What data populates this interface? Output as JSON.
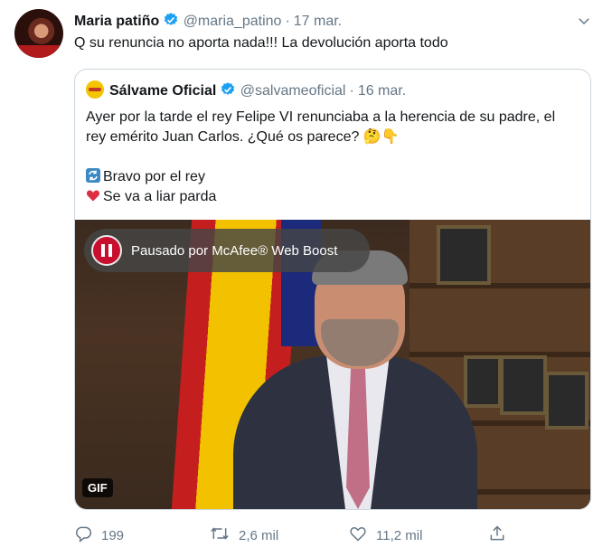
{
  "tweet": {
    "author_name": "Maria patiño",
    "handle": "@maria_patino",
    "separator": "·",
    "date": "17 mar.",
    "text": "Q su renuncia no aporta nada!!! La devolución aporta todo"
  },
  "quoted": {
    "author_name": "Sálvame Oficial",
    "handle": "@salvameoficial",
    "separator": "·",
    "date": "16 mar.",
    "lines": [
      "Ayer por la tarde el rey Felipe VI renunciaba a la herencia de su padre, el",
      "rey emérito Juan Carlos.  ¿Qué os parece? 🤔👇",
      "",
      "Bravo por el rey",
      "Se va a liar parda"
    ],
    "media": {
      "overlay_text": "Pausado por McAfee® Web Boost",
      "badge": "GIF"
    }
  },
  "actions": {
    "replies": "199",
    "retweets": "2,6 mil",
    "likes": "11,2 mil"
  },
  "colors": {
    "verified": "#1da1f2",
    "muted": "#657786",
    "border": "#ccd6dd",
    "mcafee_red": "#c8102e"
  },
  "icons": [
    "verified-badge-icon",
    "chevron-down-icon",
    "reply-icon",
    "retweet-icon",
    "like-icon",
    "share-icon",
    "counterclockwise-arrows-icon",
    "red-heart-icon",
    "pause-icon"
  ]
}
